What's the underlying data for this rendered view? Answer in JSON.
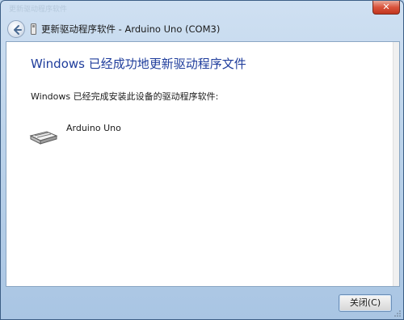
{
  "window": {
    "title_ghost": "更新驱动程序软件",
    "close_glyph": "✕"
  },
  "nav": {
    "title": "更新驱动程序软件 - Arduino Uno (COM3)"
  },
  "main": {
    "heading": "Windows 已经成功地更新驱动程序文件",
    "status": "Windows 已经完成安装此设备的驱动程序软件:",
    "device_name": "Arduino Uno"
  },
  "footer": {
    "close_label": "关闭(C)"
  },
  "colors": {
    "heading": "#1f3d9c",
    "frame": "#bcd3ea",
    "close_button": "#d9533c"
  },
  "icons": [
    "back-arrow-icon",
    "device-icon",
    "close-icon",
    "resize-grip-icon"
  ]
}
